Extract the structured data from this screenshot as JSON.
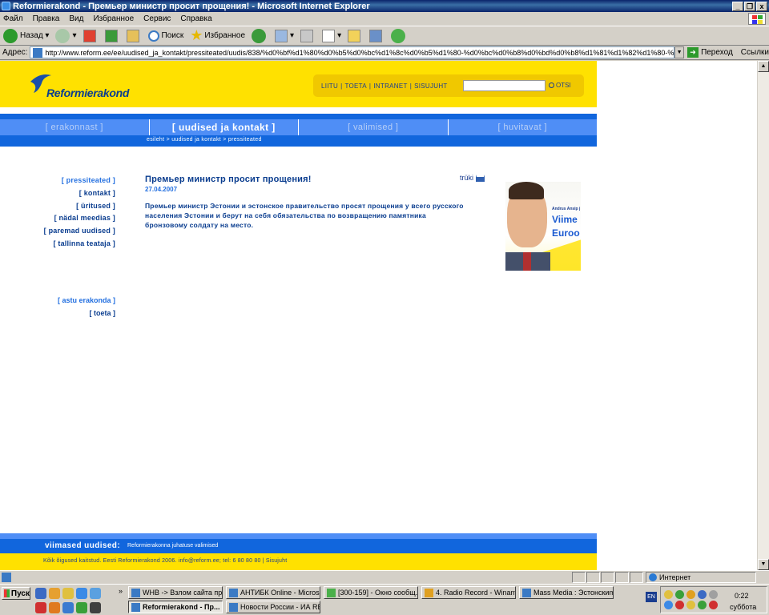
{
  "window": {
    "title": "Reformierakond - Премьер министр просит прощения! - Microsoft Internet Explorer",
    "controls": [
      "_",
      "❐",
      "x"
    ]
  },
  "menu": [
    "Файл",
    "Правка",
    "Вид",
    "Избранное",
    "Сервис",
    "Справка"
  ],
  "toolbar": {
    "back": "Назад",
    "search": "Поиск",
    "favorites": "Избранное"
  },
  "address": {
    "label": "Адрес:",
    "url": "http://www.reform.ee/ee/uudised_ja_kontakt/pressiteated/uudis/838/%d0%bf%d1%80%d0%b5%d0%bc%d1%8c%d0%b5%d1%80-%d0%bc%d0%b8%d0%bd%d0%b8%d1%81%d1%82%d1%80-%d0%bf%c",
    "go": "Переход",
    "links": "Ссылки"
  },
  "site": {
    "logo": "Reformierakond",
    "top_links": [
      "LIITU",
      "TOETA",
      "INTRANET",
      "SISUJUHT"
    ],
    "search_button": "OTSI",
    "nav": [
      {
        "label": "[ erakonnast ]",
        "active": false
      },
      {
        "label": "[ uudised ja kontakt ]",
        "active": true
      },
      {
        "label": "[ valimised ]",
        "active": false
      },
      {
        "label": "[ huvitavat ]",
        "active": false
      }
    ],
    "breadcrumb": "esileht > uudised ja kontakt > pressiteated",
    "left_nav": [
      "[ pressiteated ]",
      "[ kontakt ]",
      "[ üritused ]",
      "[ nädal meedias ]",
      "[ paremad uudised ]",
      "[ tallinna teataja ]"
    ],
    "left_nav2": [
      "[ astu erakonda ]",
      "[ toeta ]"
    ],
    "article": {
      "title": "Премьер министр просит прощения!",
      "date": "27.04.2007",
      "body": "Премьер министр Эстонии и эстонское правительство просят прощения у всего русского населения Эстонии и берут на себя обязательства по возвращению памятника бронзовому солдату на место."
    },
    "print_label": "trüki",
    "promo": {
      "name": "Andrus Ansip j",
      "line1": "Viime",
      "line2": "Euroo"
    },
    "footer_news_label": "viimased uudised:",
    "footer_news_text": "Reformierakonna juhatuse valimised",
    "footer_copy": "Kõik õigused kaitstud. Eesti Reformierakond 2006. info@reform.ee; tel: 6 80 80 80   |   Sisujuht"
  },
  "status": {
    "zone": "Интернет"
  },
  "taskbar": {
    "start": "Пуск",
    "tasks": [
      {
        "label": "WHB -> Взлом сайта пр...",
        "active": false
      },
      {
        "label": "АНТИБК Online - Micros...",
        "active": false
      },
      {
        "label": "[300-159] - Окно сообщ...",
        "active": false
      },
      {
        "label": "4. Radio Record - Winamp",
        "active": false
      },
      {
        "label": "Mass Media : Эстонскиm...",
        "active": false
      },
      {
        "label": "Reformierakond - Пр...",
        "active": true
      },
      {
        "label": "Новости России - ИА RE...",
        "active": false
      }
    ],
    "lang": "EN",
    "clock": "0:22",
    "day": "суббота"
  }
}
